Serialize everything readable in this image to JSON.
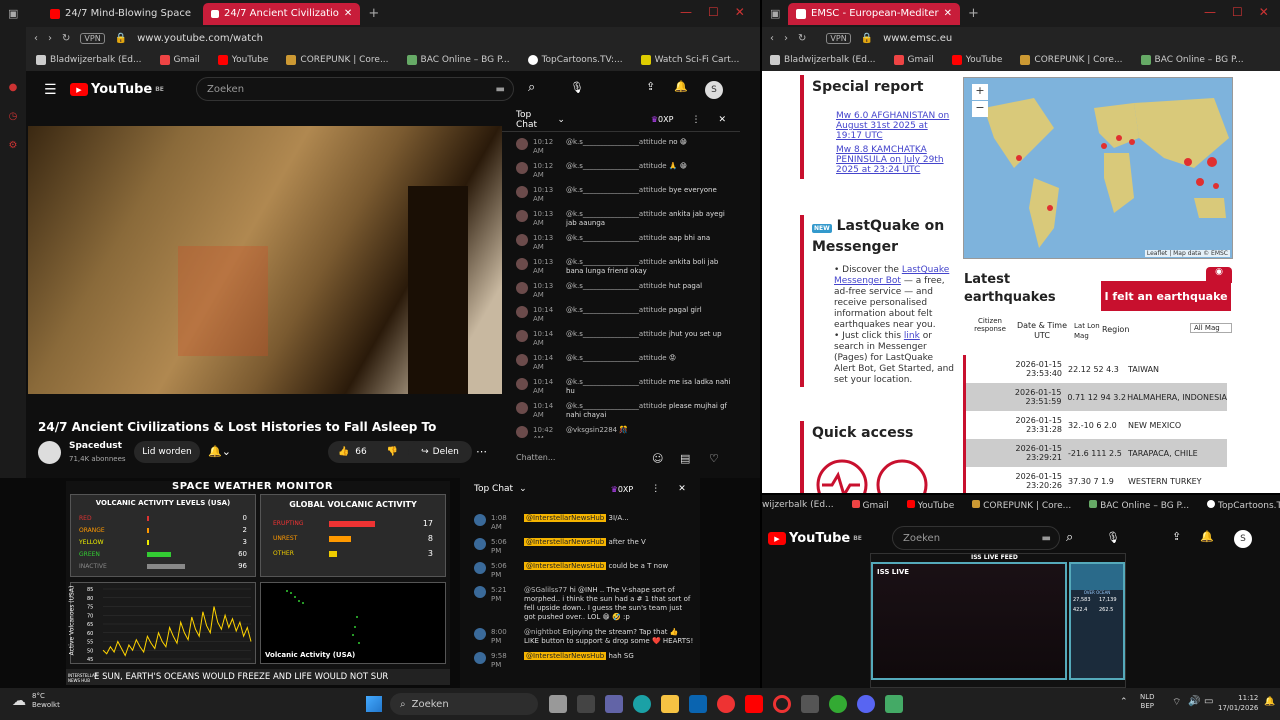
{
  "left_browser": {
    "tabs": [
      {
        "label": "24/7 Mind-Blowing Space"
      },
      {
        "label": "24/7 Ancient Civilizatio"
      }
    ],
    "url": "www.youtube.com/watch",
    "vpn": "VPN",
    "bookmarks": [
      "Bladwijzerbalk (Ed...",
      "Gmail",
      "YouTube",
      "COREPUNK | Core...",
      "BAC Online – BG P...",
      "TopCartoons.TV:...",
      "Watch Sci-Fi Cart..."
    ]
  },
  "yt1": {
    "logo": "YouTube",
    "country": "BE",
    "search_placeholder": "Zoeken",
    "avatar": "S",
    "title": "24/7 Ancient Civilizations & Lost Histories to Fall Asleep To",
    "channel": "Spacedust",
    "subs": "71,4K abonnees",
    "join": "Lid worden",
    "likes": "66",
    "share": "Delen",
    "chat_header": "Top Chat",
    "chat_badge": "0XP",
    "chat_input": "Chatten...",
    "messages": [
      {
        "t": "10:12 AM",
        "u": "@k.s________________attitude",
        "m": "no 😁"
      },
      {
        "t": "10:12 AM",
        "u": "@k.s________________attitude",
        "m": "🙏 😁"
      },
      {
        "t": "10:13 AM",
        "u": "@k.s________________attitude",
        "m": "bye everyone"
      },
      {
        "t": "10:13 AM",
        "u": "@k.s________________attitude",
        "m": "ankita jab ayegi jab aaunga"
      },
      {
        "t": "10:13 AM",
        "u": "@k.s________________attitude",
        "m": "aap bhi ana"
      },
      {
        "t": "10:13 AM",
        "u": "@k.s________________attitude",
        "m": "ankita boli jab bana lunga friend okay"
      },
      {
        "t": "10:13 AM",
        "u": "@k.s________________attitude",
        "m": "hut pagal"
      },
      {
        "t": "10:14 AM",
        "u": "@k.s________________attitude",
        "m": "pagal girl"
      },
      {
        "t": "10:14 AM",
        "u": "@k.s________________attitude",
        "m": "jhut you set up"
      },
      {
        "t": "10:14 AM",
        "u": "@k.s________________attitude",
        "m": "😡"
      },
      {
        "t": "10:14 AM",
        "u": "@k.s________________attitude",
        "m": "me isa ladka nahi hu"
      },
      {
        "t": "10:14 AM",
        "u": "@k.s________________attitude",
        "m": "please mujhai gf nahi chayai"
      },
      {
        "t": "10:42 AM",
        "u": "@vksgsin2284",
        "m": "🎊"
      }
    ]
  },
  "space": {
    "title": "SPACE WEATHER MONITOR",
    "vol_title": "VOLCANIC ACTIVITY LEVELS (USA)",
    "vol_rows": [
      {
        "name": "RED",
        "v": "0",
        "frac": 0.0,
        "color": "#d33"
      },
      {
        "name": "ORANGE",
        "v": "2",
        "frac": 0.02,
        "color": "#f90"
      },
      {
        "name": "YELLOW",
        "v": "3",
        "frac": 0.03,
        "color": "#ee0"
      },
      {
        "name": "GREEN",
        "v": "60",
        "frac": 0.6,
        "color": "#3c3"
      },
      {
        "name": "INACTIVE",
        "v": "96",
        "frac": 0.96,
        "color": "#888"
      }
    ],
    "global_title": "GLOBAL VOLCANIC ACTIVITY",
    "global_rows": [
      {
        "name": "ERUPTING",
        "v": "17",
        "frac": 0.85,
        "color": "#e33"
      },
      {
        "name": "UNREST",
        "v": "8",
        "frac": 0.4,
        "color": "#f90"
      },
      {
        "name": "OTHER",
        "v": "3",
        "frac": 0.15,
        "color": "#ec0"
      }
    ],
    "ylabel": "Active Volcanoes (USA)",
    "yticks": [
      "85",
      "80",
      "75",
      "70",
      "65",
      "60",
      "55",
      "50",
      "45"
    ],
    "map_label": "Volcanic Activity (USA)",
    "ticker": "E SUN, EARTH'S OCEANS WOULD FREEZE AND LIFE WOULD NOT SUR",
    "logo": "INTERSTELLAR NEWS HUB",
    "chart_data": {
      "type": "line",
      "title": "",
      "xlabel": "",
      "ylabel": "Active Volcanoes (USA)",
      "ylim": [
        45,
        85
      ],
      "values": [
        50,
        48,
        52,
        49,
        55,
        51,
        47,
        53,
        50,
        56,
        52,
        49,
        58,
        54,
        51,
        60,
        55,
        52,
        63,
        58,
        54,
        66,
        60,
        56,
        69,
        62,
        58,
        72,
        64,
        60,
        75,
        66,
        62,
        70,
        63,
        68,
        61,
        66,
        58,
        63,
        55
      ]
    }
  },
  "chat2": {
    "header": "Top Chat",
    "badge": "0XP",
    "messages": [
      {
        "t": "1:08 AM",
        "u": "@InterstellarNewsHub",
        "m": "3I/A..."
      },
      {
        "t": "5:06 PM",
        "u": "@InterstellarNewsHub",
        "m": "after the V"
      },
      {
        "t": "5:06 PM",
        "u": "@InterstellarNewsHub",
        "m": "could be a T now"
      },
      {
        "t": "5:21 PM",
        "u": "@SGalilss77",
        "m": "hi @INH .. The V-shape sort of morphed.. i think the sun had a # 1 that sort of fell upside down.. I guess the sun's team just got pushed over.. LOL 😁 🤣 :p"
      },
      {
        "t": "8:00 PM",
        "u": "@nightbot",
        "m": "Enjoying the stream? Tap that 👍 LIKE button to support & drop some ❤️ HEARTS!"
      },
      {
        "t": "9:58 PM",
        "u": "@InterstellarNewsHub",
        "m": "hah SG"
      }
    ]
  },
  "emsc": {
    "tab": "EMSC - European-Mediter",
    "url": "www.emsc.eu",
    "vpn": "VPN",
    "bookmarks": [
      "Bladwijzerbalk (Ed...",
      "Gmail",
      "YouTube",
      "COREPUNK | Core...",
      "BAC Online – BG P..."
    ],
    "special_report": "Special report",
    "links": [
      "Mw 6.0 AFGHANISTAN on August 31st 2025 at 19:17 UTC",
      "Mw 8.8 KAMCHATKA PENINSULA on July 29th 2025 at 23:24 UTC"
    ],
    "lastquake_title": "LastQuake on Messenger",
    "new": "NEW",
    "lq_text1": "Discover the",
    "lq_link1": "LastQuake Messenger Bot",
    "lq_text2": "— a free, ad-free service — and receive personalised information about felt earthquakes near you.",
    "lq_text3": "Just click this",
    "lq_link2": "link",
    "lq_text4": "or search in Messenger (Pages) for LastQuake Alert Bot, Get Started, and set your location.",
    "quick": "Quick access",
    "map_attr": "Leaflet | Map data © EMSC",
    "latest": "Latest earthquakes",
    "felt_btn": "I felt an earthquake",
    "cols": [
      "Citizen response",
      "Date & Time UTC",
      "Lat Lon Mag",
      "Region",
      "All Mag"
    ],
    "rows": [
      {
        "d": "2026-01-15",
        "tm": "23:53:40",
        "v": "22.12 52 4.3",
        "r": "TAIWAN"
      },
      {
        "d": "2026-01-15",
        "tm": "23:51:59",
        "v": "0.71 12 94 3.2",
        "r": "HALMAHERA, INDONESIA"
      },
      {
        "d": "2026-01-15",
        "tm": "23:31:28",
        "v": "32.-10 6 2.0",
        "r": "NEW MEXICO"
      },
      {
        "d": "2026-01-15",
        "tm": "23:29:21",
        "v": "-21.6 111 2.5",
        "r": "TARAPACA, CHILE"
      },
      {
        "d": "2026-01-15",
        "tm": "23:20:26",
        "v": "37.30 7 1.9",
        "r": "WESTERN TURKEY"
      }
    ]
  },
  "yt2": {
    "bookmarks": [
      "wijzerbalk (Ed...",
      "Gmail",
      "YouTube",
      "COREPUNK | Core...",
      "BAC Online – BG P...",
      "TopCartoons.TV:..."
    ],
    "logo": "YouTube",
    "country": "BE",
    "search_placeholder": "Zoeken",
    "avatar": "S",
    "feed_label": "ISS LIVE FEED",
    "iss": "ISS LIVE",
    "over": "OVER OCEAN",
    "n1": "27,583",
    "n2": "17,139",
    "n3": "422.4",
    "n4": "262.5"
  },
  "taskbar": {
    "temp": "8°C",
    "weather": "Bewolkt",
    "search": "Zoeken",
    "lang1": "NLD",
    "lang2": "BEP",
    "time": "11:12",
    "date": "17/01/2026"
  },
  "colors": {
    "yt_red": "#ff0000",
    "emsc_red": "#c8102e",
    "tab_active": "#c81d3a"
  }
}
